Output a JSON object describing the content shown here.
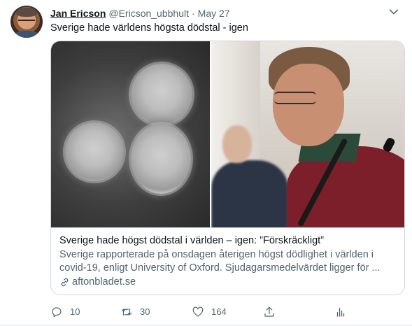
{
  "tweet": {
    "author_name": "Jan Ericson",
    "author_handle": "@Ericson_ubbhult",
    "separator": "·",
    "date": "May 27",
    "text": "Sverige hade världens högsta dödstal - igen",
    "menu_icon": "chevron-down-icon"
  },
  "card": {
    "title": "Sverige hade högst dödstal i världen – igen: ”Förskräckligt”",
    "description_line1": "Sverige rapporterade på onsdagen återigen högst dödlighet i världen i",
    "description_line2": "covid-19, enligt University of Oxford. Sjudagarsmedelvärdet ligger för ...",
    "domain": "aftonbladet.se",
    "domain_icon": "link-icon",
    "images": [
      "coronavirus-micrograph",
      "man-with-glasses-at-microphone"
    ]
  },
  "actions": {
    "reply": {
      "icon": "reply-icon",
      "count": "10"
    },
    "retweet": {
      "icon": "retweet-icon",
      "count": "30"
    },
    "like": {
      "icon": "heart-icon",
      "count": "164"
    },
    "share": {
      "icon": "share-icon"
    },
    "analytics": {
      "icon": "analytics-icon"
    }
  },
  "colors": {
    "text": "#0f1419",
    "secondary_text": "#536471",
    "border": "#cfd9de"
  }
}
